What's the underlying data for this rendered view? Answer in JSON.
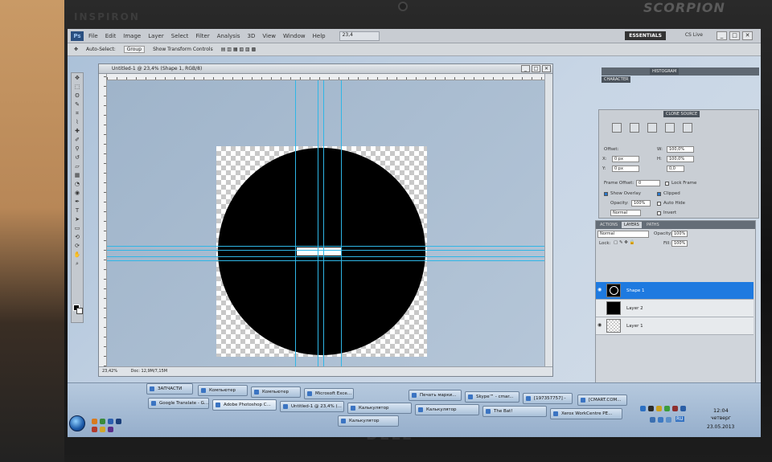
{
  "bezel": {
    "brand": "INSPIRON",
    "brand_right": "SCORPION",
    "logo": "DELL"
  },
  "app": {
    "logo": "Ps",
    "menu": [
      "File",
      "Edit",
      "Image",
      "Layer",
      "Select",
      "Filter",
      "Analysis",
      "3D",
      "View",
      "Window",
      "Help"
    ],
    "zoom": "23,4",
    "workspace": "ESSENTIALS",
    "cslive": "CS Live",
    "window_buttons": [
      "_",
      "□",
      "✕"
    ]
  },
  "options": {
    "auto_select": "Auto-Select:",
    "group": "Group",
    "show_transform": "Show Transform Controls"
  },
  "document": {
    "title": "Untitled-1 @ 23,4% (Shape 1, RGB/8)",
    "zoom_status": "23,42%",
    "doc_status": "Doc: 12,9M/7,15M"
  },
  "panels": {
    "tabs_top": [
      "HISTOGRAM",
      "CHARACTER",
      "CLONE SOURCE"
    ],
    "clone_source": {
      "offset_label": "Offset:",
      "w_label": "W:",
      "w_value": "100,0%",
      "h_label": "H:",
      "h_value": "100,0%",
      "x_label": "X:",
      "x_value": "0 px",
      "y_label": "Y:",
      "y_value": "0 px",
      "angle_value": "0,0",
      "frame_offset_label": "Frame Offset:",
      "frame_offset_value": "0",
      "lock_frame": "Lock Frame",
      "show_overlay": "Show Overlay",
      "clipped": "Clipped",
      "opacity_label": "Opacity:",
      "opacity_value": "100%",
      "auto_hide": "Auto Hide",
      "mode": "Normal",
      "invert": "Invert"
    },
    "layers": {
      "tabs": [
        "ACTIONS",
        "LAYERS",
        "PATHS"
      ],
      "blend_mode": "Normal",
      "opacity_label": "Opacity:",
      "opacity_value": "100%",
      "lock_label": "Lock:",
      "fill_label": "Fill:",
      "fill_value": "100%",
      "items": [
        {
          "name": "Shape 1",
          "selected": true,
          "visible": true
        },
        {
          "name": "Layer 2",
          "selected": false,
          "visible": false
        },
        {
          "name": "Layer 1",
          "selected": false,
          "visible": true
        }
      ]
    }
  },
  "taskbar": {
    "row1": [
      "ЗАПЧАСТИ",
      "Компьютер",
      "Компьютер",
      "Microsoft Exce...",
      "Печать марки...",
      "Skype™ - cmar...",
      "[197357757] -",
      "[CMART.COM..."
    ],
    "row2": [
      "Google Translate - G...",
      "Adobe Photoshop C...",
      "Untitled-1 @ 23,4% (...",
      "Калькулятор",
      "Калькулятор",
      "The Bat!",
      "Xerox WorkCentre PE..."
    ],
    "row3": [
      "Калькулятор"
    ],
    "clock_time": "12:04",
    "clock_day": "четверг",
    "clock_date": "23.05.2013",
    "language": "RU"
  }
}
